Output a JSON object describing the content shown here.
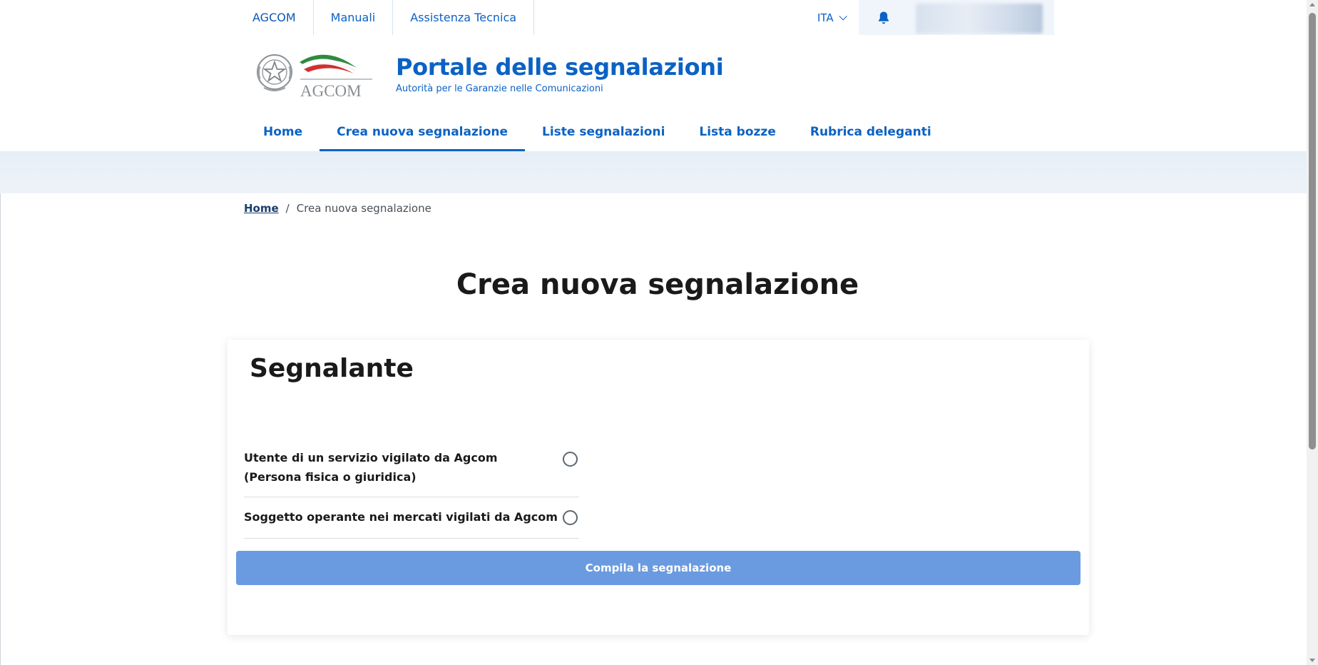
{
  "topbar": {
    "links": [
      "AGCOM",
      "Manuali",
      "Assistenza Tecnica"
    ],
    "language": "ITA"
  },
  "header": {
    "logo_text": "AGCOM",
    "title": "Portale delle segnalazioni",
    "subtitle": "Autorità per le Garanzie nelle Comunicazioni"
  },
  "nav": {
    "items": [
      "Home",
      "Crea nuova segnalazione",
      "Liste segnalazioni",
      "Lista bozze",
      "Rubrica deleganti"
    ],
    "active": "Crea nuova segnalazione"
  },
  "breadcrumb": {
    "home": "Home",
    "separator": "/",
    "current": "Crea nuova segnalazione"
  },
  "page": {
    "title": "Crea nuova segnalazione"
  },
  "form": {
    "section_title": "Segnalante",
    "options": [
      "Utente di un servizio vigilato da Agcom (Persona fisica o giuridica)",
      "Soggetto operante nei mercati vigilati da Agcom"
    ],
    "submit_label": "Compila la segnalazione"
  },
  "colors": {
    "primary": "#0b62c4",
    "button_disabled": "#6a9be0",
    "band": "#e6eef7"
  }
}
